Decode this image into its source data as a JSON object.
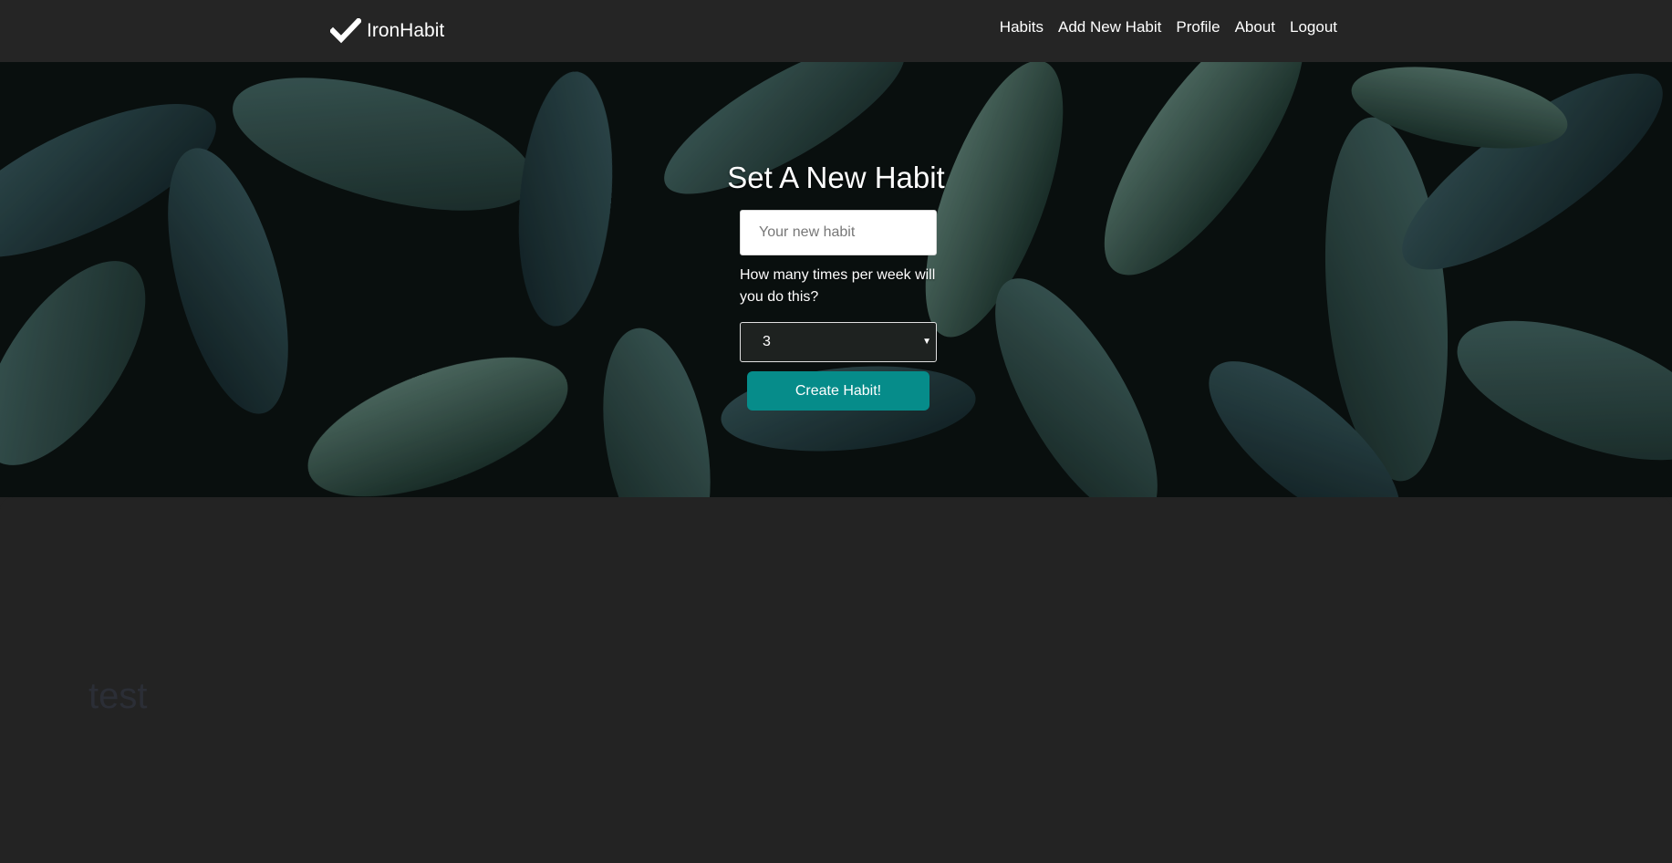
{
  "navbar": {
    "brand": "IronHabit",
    "brand_icon": "checkmark-icon",
    "links": [
      "Habits",
      "Add New Habit",
      "Profile",
      "About",
      "Logout"
    ]
  },
  "form": {
    "title": "Set A New Habit",
    "input_placeholder": "Your new habit",
    "frequency_label": "How many times per week will you do this?",
    "frequency_value": "3",
    "submit_label": "Create Habit!"
  },
  "habits": [
    {
      "name": "test"
    }
  ],
  "colors": {
    "navbar_bg": "#252525",
    "page_bg": "#232323",
    "accent": "#068c8a",
    "habit_text": "#2b2e36"
  }
}
